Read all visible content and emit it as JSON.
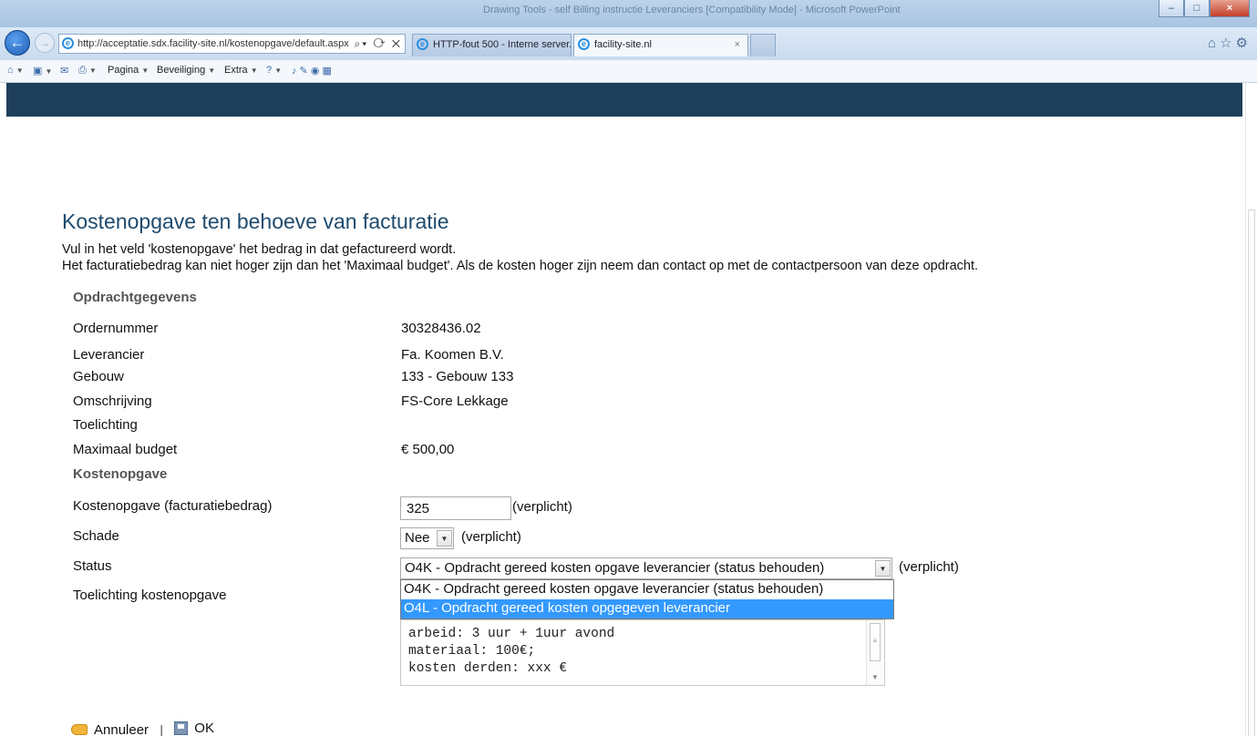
{
  "browser": {
    "window_title": "Drawing Tools - self Billing instructie Leveranciers [Compatibility Mode] - Microsoft PowerPoint",
    "address": "http://acceptatie.sdx.facility-site.nl/kostenopgave/default.aspx",
    "tabs": [
      {
        "label": "HTTP-fout 500 - Interne server..."
      },
      {
        "label": "facility-site.nl"
      }
    ],
    "command_bar": {
      "pagina": "Pagina",
      "beveiliging": "Beveiliging",
      "extra": "Extra"
    }
  },
  "page": {
    "title": "Kostenopgave ten behoeve van facturatie",
    "intro_line1": "Vul in het veld 'kostenopgave' het bedrag in dat gefactureerd wordt.",
    "intro_line2": "Het facturatiebedrag kan niet hoger zijn dan het 'Maximaal budget'. Als de kosten hoger zijn neem dan contact op met de contactpersoon van deze opdracht."
  },
  "order": {
    "section_title": "Opdrachtgegevens",
    "ordernummer_label": "Ordernummer",
    "ordernummer_value": "30328436.02",
    "leverancier_label": "Leverancier",
    "leverancier_value": "Fa. Koomen B.V.",
    "gebouw_label": "Gebouw",
    "gebouw_value": "133 - Gebouw 133",
    "omschrijving_label": "Omschrijving",
    "omschrijving_value": "FS-Core Lekkage",
    "toelichting_label": "Toelichting",
    "budget_label": "Maximaal budget",
    "budget_value": "€ 500,00"
  },
  "cost": {
    "section_title": "Kostenopgave",
    "amount_label": "Kostenopgave (facturatiebedrag)",
    "amount_value": "325",
    "required_text": "(verplicht)",
    "schade_label": "Schade",
    "schade_value": "Nee",
    "status_label": "Status",
    "status_value": "O4K - Opdracht gereed kosten opgave leverancier (status behouden)",
    "status_options": [
      "O4K - Opdracht gereed kosten opgave leverancier (status behouden)",
      "O4L - Opdracht gereed kosten opgegeven leverancier"
    ],
    "highlighted_option_index": 1,
    "toelichting_label": "Toelichting kostenopgave",
    "toelichting_lines": [
      "arbeid: 3 uur + 1uur avond",
      "materiaal: 100€;",
      "kosten derden: xxx €"
    ]
  },
  "actions": {
    "cancel_label": "Annuleer",
    "separator": "|",
    "ok_label": "OK"
  },
  "colors": {
    "banner": "#1e3f5a",
    "title": "#1f4b6e",
    "highlight": "#3399ff"
  }
}
